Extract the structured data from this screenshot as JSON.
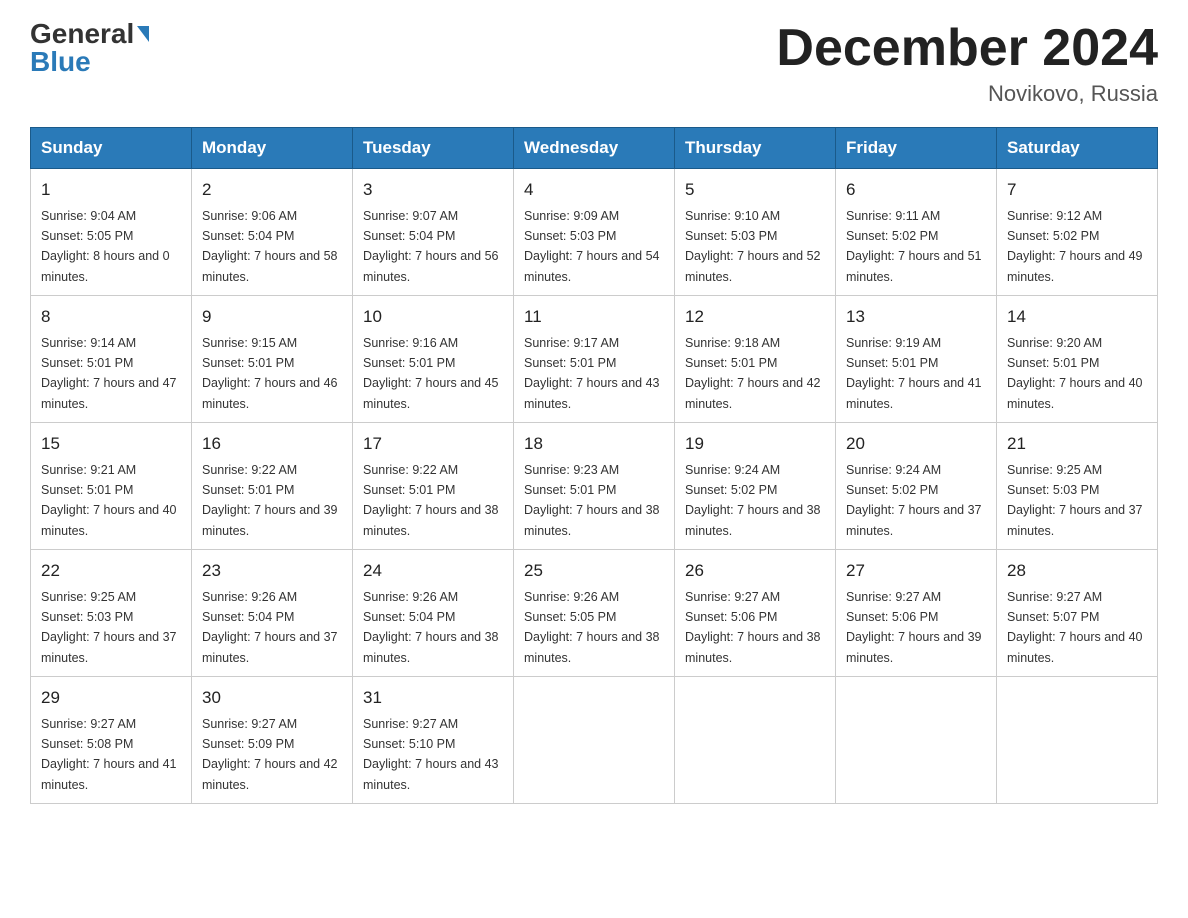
{
  "header": {
    "logo_general": "General",
    "logo_blue": "Blue",
    "month_title": "December 2024",
    "location": "Novikovo, Russia"
  },
  "days_of_week": [
    "Sunday",
    "Monday",
    "Tuesday",
    "Wednesday",
    "Thursday",
    "Friday",
    "Saturday"
  ],
  "weeks": [
    [
      {
        "day": "1",
        "sunrise": "9:04 AM",
        "sunset": "5:05 PM",
        "daylight": "8 hours and 0 minutes."
      },
      {
        "day": "2",
        "sunrise": "9:06 AM",
        "sunset": "5:04 PM",
        "daylight": "7 hours and 58 minutes."
      },
      {
        "day": "3",
        "sunrise": "9:07 AM",
        "sunset": "5:04 PM",
        "daylight": "7 hours and 56 minutes."
      },
      {
        "day": "4",
        "sunrise": "9:09 AM",
        "sunset": "5:03 PM",
        "daylight": "7 hours and 54 minutes."
      },
      {
        "day": "5",
        "sunrise": "9:10 AM",
        "sunset": "5:03 PM",
        "daylight": "7 hours and 52 minutes."
      },
      {
        "day": "6",
        "sunrise": "9:11 AM",
        "sunset": "5:02 PM",
        "daylight": "7 hours and 51 minutes."
      },
      {
        "day": "7",
        "sunrise": "9:12 AM",
        "sunset": "5:02 PM",
        "daylight": "7 hours and 49 minutes."
      }
    ],
    [
      {
        "day": "8",
        "sunrise": "9:14 AM",
        "sunset": "5:01 PM",
        "daylight": "7 hours and 47 minutes."
      },
      {
        "day": "9",
        "sunrise": "9:15 AM",
        "sunset": "5:01 PM",
        "daylight": "7 hours and 46 minutes."
      },
      {
        "day": "10",
        "sunrise": "9:16 AM",
        "sunset": "5:01 PM",
        "daylight": "7 hours and 45 minutes."
      },
      {
        "day": "11",
        "sunrise": "9:17 AM",
        "sunset": "5:01 PM",
        "daylight": "7 hours and 43 minutes."
      },
      {
        "day": "12",
        "sunrise": "9:18 AM",
        "sunset": "5:01 PM",
        "daylight": "7 hours and 42 minutes."
      },
      {
        "day": "13",
        "sunrise": "9:19 AM",
        "sunset": "5:01 PM",
        "daylight": "7 hours and 41 minutes."
      },
      {
        "day": "14",
        "sunrise": "9:20 AM",
        "sunset": "5:01 PM",
        "daylight": "7 hours and 40 minutes."
      }
    ],
    [
      {
        "day": "15",
        "sunrise": "9:21 AM",
        "sunset": "5:01 PM",
        "daylight": "7 hours and 40 minutes."
      },
      {
        "day": "16",
        "sunrise": "9:22 AM",
        "sunset": "5:01 PM",
        "daylight": "7 hours and 39 minutes."
      },
      {
        "day": "17",
        "sunrise": "9:22 AM",
        "sunset": "5:01 PM",
        "daylight": "7 hours and 38 minutes."
      },
      {
        "day": "18",
        "sunrise": "9:23 AM",
        "sunset": "5:01 PM",
        "daylight": "7 hours and 38 minutes."
      },
      {
        "day": "19",
        "sunrise": "9:24 AM",
        "sunset": "5:02 PM",
        "daylight": "7 hours and 38 minutes."
      },
      {
        "day": "20",
        "sunrise": "9:24 AM",
        "sunset": "5:02 PM",
        "daylight": "7 hours and 37 minutes."
      },
      {
        "day": "21",
        "sunrise": "9:25 AM",
        "sunset": "5:03 PM",
        "daylight": "7 hours and 37 minutes."
      }
    ],
    [
      {
        "day": "22",
        "sunrise": "9:25 AM",
        "sunset": "5:03 PM",
        "daylight": "7 hours and 37 minutes."
      },
      {
        "day": "23",
        "sunrise": "9:26 AM",
        "sunset": "5:04 PM",
        "daylight": "7 hours and 37 minutes."
      },
      {
        "day": "24",
        "sunrise": "9:26 AM",
        "sunset": "5:04 PM",
        "daylight": "7 hours and 38 minutes."
      },
      {
        "day": "25",
        "sunrise": "9:26 AM",
        "sunset": "5:05 PM",
        "daylight": "7 hours and 38 minutes."
      },
      {
        "day": "26",
        "sunrise": "9:27 AM",
        "sunset": "5:06 PM",
        "daylight": "7 hours and 38 minutes."
      },
      {
        "day": "27",
        "sunrise": "9:27 AM",
        "sunset": "5:06 PM",
        "daylight": "7 hours and 39 minutes."
      },
      {
        "day": "28",
        "sunrise": "9:27 AM",
        "sunset": "5:07 PM",
        "daylight": "7 hours and 40 minutes."
      }
    ],
    [
      {
        "day": "29",
        "sunrise": "9:27 AM",
        "sunset": "5:08 PM",
        "daylight": "7 hours and 41 minutes."
      },
      {
        "day": "30",
        "sunrise": "9:27 AM",
        "sunset": "5:09 PM",
        "daylight": "7 hours and 42 minutes."
      },
      {
        "day": "31",
        "sunrise": "9:27 AM",
        "sunset": "5:10 PM",
        "daylight": "7 hours and 43 minutes."
      },
      null,
      null,
      null,
      null
    ]
  ]
}
